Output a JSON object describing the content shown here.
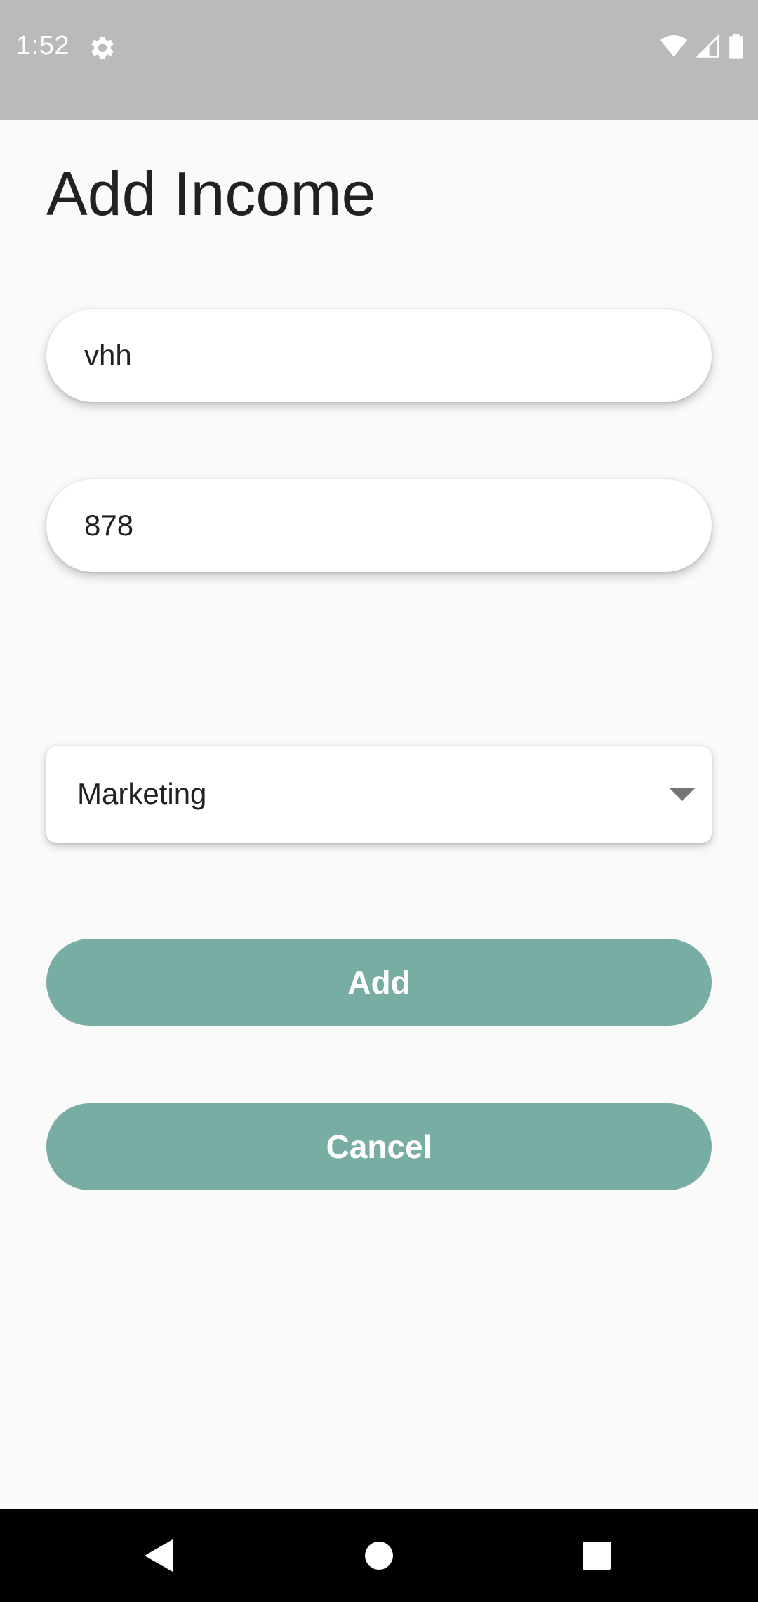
{
  "status_bar": {
    "time": "1:52",
    "icons": [
      "gear-icon",
      "wifi-icon",
      "signal-icon",
      "battery-icon"
    ]
  },
  "page": {
    "title": "Add Income"
  },
  "form": {
    "name_value": "vhh",
    "amount_value": "878",
    "category_selected": "Marketing"
  },
  "buttons": {
    "add_label": "Add",
    "cancel_label": "Cancel"
  },
  "colors": {
    "background": "#fafafa",
    "status_bar": "#bababa",
    "button": "#78ada3",
    "nav_bar": "#000000"
  },
  "nav": {
    "icons": [
      "back-icon",
      "home-icon",
      "recents-icon"
    ]
  }
}
